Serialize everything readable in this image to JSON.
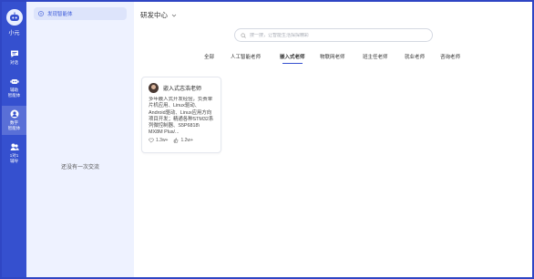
{
  "app": {
    "logo_label": "小元"
  },
  "rail": {
    "items": [
      {
        "label": "对话"
      },
      {
        "label": "辅助\n智能体"
      },
      {
        "label": "数字\n智能体"
      },
      {
        "label": "1对1\n辅导"
      }
    ]
  },
  "history": {
    "new_chat_label": "发现智能体",
    "empty_text": "还没有一次交流"
  },
  "main": {
    "center_title": "研发中心",
    "search": {
      "placeholder": "搜一搜，让智能生活探探精彩"
    },
    "tabs": [
      {
        "label": "全部"
      },
      {
        "label": "人工智能老师"
      },
      {
        "label": "嵌入式老师"
      },
      {
        "label": "物联网老师"
      },
      {
        "label": "班主任老师"
      },
      {
        "label": "就业老师"
      },
      {
        "label": "咨询老师"
      }
    ],
    "active_tab_index": 2,
    "cards": [
      {
        "title": "嵌入式志浩老师",
        "description": "多年嵌入式开发经验，负责单片机应用、Linux驱动、Android驱动、Linux应用方向项目开发；精通各种STM32系列微控制器、S5P6818\\ MX8M Plus/...",
        "likes": "1.3w+",
        "uses": "1.2w+"
      }
    ]
  },
  "colors": {
    "rail_bg": "#3550cf",
    "accent": "#3550cf",
    "history_bg": "#eef2ff"
  }
}
